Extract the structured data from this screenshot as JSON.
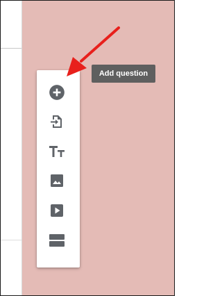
{
  "toolbar": {
    "items": [
      {
        "name": "add-question",
        "icon": "add-circle-icon"
      },
      {
        "name": "import-questions",
        "icon": "import-icon"
      },
      {
        "name": "add-title-and-description",
        "icon": "title-text-icon"
      },
      {
        "name": "add-image",
        "icon": "image-icon"
      },
      {
        "name": "add-video",
        "icon": "video-icon"
      },
      {
        "name": "add-section",
        "icon": "section-icon"
      }
    ]
  },
  "tooltip": {
    "text": "Add question"
  },
  "colors": {
    "background": "#e4bbb6",
    "icon": "#5f6368",
    "tooltip_bg": "#5f5f5f",
    "arrow": "#e8201c"
  }
}
